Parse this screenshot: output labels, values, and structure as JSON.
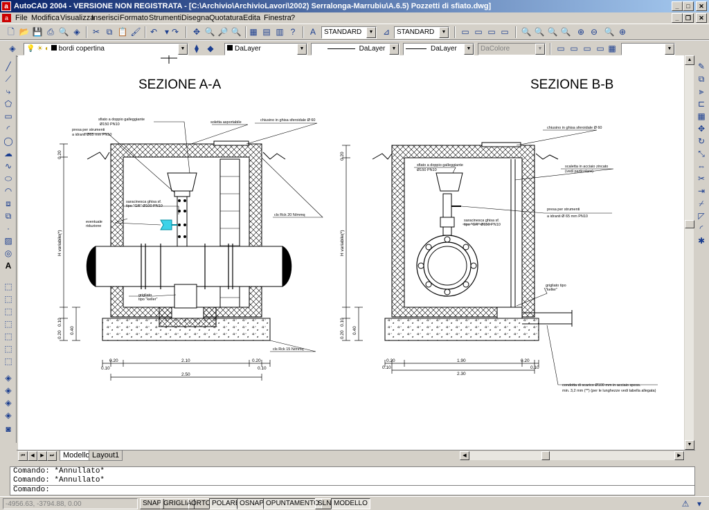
{
  "window": {
    "title": "AutoCAD 2004 - VERSIONE NON REGISTRATA - [C:\\Archivio\\ArchivioLavori\\2002) Serralonga-Marrubiu\\A.6.5) Pozzetti di sfiato.dwg]",
    "app_icon": "autocad-icon"
  },
  "menu": {
    "items": [
      "File",
      "Modifica",
      "Visualizza",
      "Inserisci",
      "Formato",
      "Strumenti",
      "Disegna",
      "Quotatura",
      "Edita",
      "Finestra",
      "?"
    ]
  },
  "toolbar": {
    "text_style": "STANDARD",
    "dim_style": "STANDARD"
  },
  "properties": {
    "layer": "bordi copertina",
    "color": "DaLayer",
    "linetype": "DaLayer",
    "lineweight": "DaLayer",
    "plotstyle": "DaColore"
  },
  "drawing": {
    "section_a_title": "SEZIONE A-A",
    "section_b_title": "SEZIONE B-B",
    "a_labels": {
      "sfiato": "sfiato a doppio galleggiante",
      "sfiato_size": "Ø150 PN10",
      "presa": "presa per strumenti",
      "presa2": "a idranti Ø65 mm PN10",
      "soletta": "soletta asportabile",
      "chiusino": "chiusino in ghisa sferoidale Ø 60",
      "saracinesca": "saracinesca ghisa sf.",
      "saracinesca2": "tipo \"GR\" Ø100 PN10",
      "riduzione": "eventuale",
      "riduzione2": "riduzione",
      "cls1": "cls Rck 20 N/mmq",
      "grigliato": "grigliato",
      "grigliato2": "tipo \"keller\"",
      "cls2": "cls Rck 15 N/mmq",
      "h_var": "H variabile(*)",
      "d020": "0.20",
      "d010": "0.10",
      "d040": "0.40",
      "dim_210": "2.10",
      "dim_250": "2.50"
    },
    "b_labels": {
      "chiusino": "chiusino in ghisa sferoidale Ø 60",
      "sfiato": "sfiato a doppio galleggiante",
      "sfiato_size": "Ø150 PN10",
      "scaletta": "scaletta in acciaio zincato",
      "scaletta2": "(vedi particolare)",
      "presa": "presa per strumenti",
      "presa2": "a idranti Ø 65 mm PN10",
      "saracinesca": "saracinesca ghisa sf.",
      "saracinesca2": "tipo \"GR\" Ø150 PN10",
      "grigliato": "grigliato tipo",
      "grigliato2": "\"keller\"",
      "condotta": "condotta di scarico Ø100 mm in acciaio spess.",
      "condotta2": "min. 3,2 mm (**) (per le lunghezze vedi tabella allegata)",
      "h_var": "H variabile(*)",
      "dim_190": "1.90",
      "dim_230": "2.30",
      "d020": "0.20",
      "d010": "0.10",
      "d040": "0.40"
    }
  },
  "layout_tabs": [
    "Modello",
    "Layout1"
  ],
  "command": {
    "lines": [
      "Comando: *Annullato*",
      "Comando: *Annullato*"
    ],
    "prompt": "Comando:"
  },
  "status": {
    "coords": "-4956.63, -3794.88, 0.00",
    "buttons": [
      "SNAP",
      "GRIGLIA",
      "ORTO",
      "POLARE",
      "OSNAP",
      "OPUNTAMENTO",
      "SLN",
      "MODELLO"
    ]
  }
}
